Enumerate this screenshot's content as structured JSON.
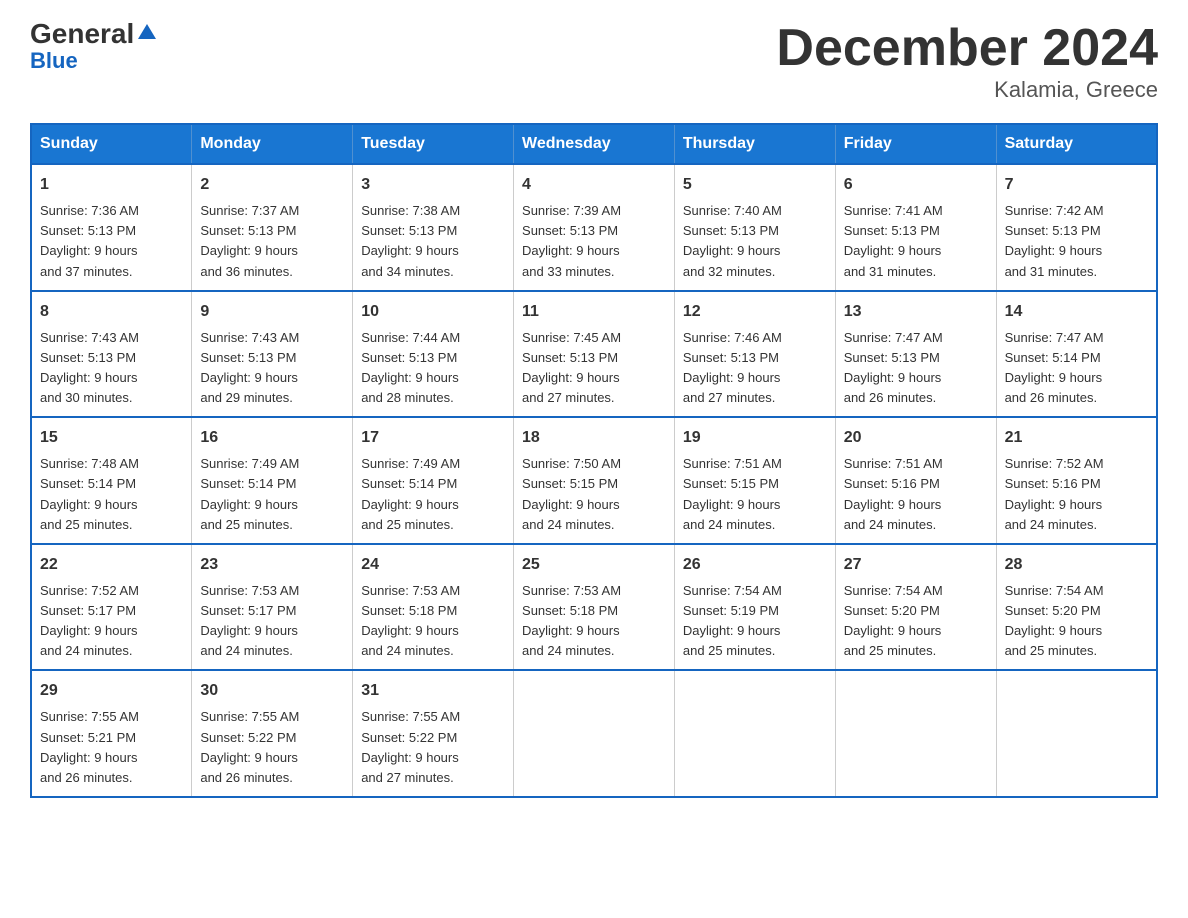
{
  "logo": {
    "name_general": "General",
    "name_blue": "Blue"
  },
  "title": "December 2024",
  "subtitle": "Kalamia, Greece",
  "days_header": [
    "Sunday",
    "Monday",
    "Tuesday",
    "Wednesday",
    "Thursday",
    "Friday",
    "Saturday"
  ],
  "weeks": [
    [
      {
        "day": "1",
        "sunrise": "7:36 AM",
        "sunset": "5:13 PM",
        "daylight": "9 hours and 37 minutes."
      },
      {
        "day": "2",
        "sunrise": "7:37 AM",
        "sunset": "5:13 PM",
        "daylight": "9 hours and 36 minutes."
      },
      {
        "day": "3",
        "sunrise": "7:38 AM",
        "sunset": "5:13 PM",
        "daylight": "9 hours and 34 minutes."
      },
      {
        "day": "4",
        "sunrise": "7:39 AM",
        "sunset": "5:13 PM",
        "daylight": "9 hours and 33 minutes."
      },
      {
        "day": "5",
        "sunrise": "7:40 AM",
        "sunset": "5:13 PM",
        "daylight": "9 hours and 32 minutes."
      },
      {
        "day": "6",
        "sunrise": "7:41 AM",
        "sunset": "5:13 PM",
        "daylight": "9 hours and 31 minutes."
      },
      {
        "day": "7",
        "sunrise": "7:42 AM",
        "sunset": "5:13 PM",
        "daylight": "9 hours and 31 minutes."
      }
    ],
    [
      {
        "day": "8",
        "sunrise": "7:43 AM",
        "sunset": "5:13 PM",
        "daylight": "9 hours and 30 minutes."
      },
      {
        "day": "9",
        "sunrise": "7:43 AM",
        "sunset": "5:13 PM",
        "daylight": "9 hours and 29 minutes."
      },
      {
        "day": "10",
        "sunrise": "7:44 AM",
        "sunset": "5:13 PM",
        "daylight": "9 hours and 28 minutes."
      },
      {
        "day": "11",
        "sunrise": "7:45 AM",
        "sunset": "5:13 PM",
        "daylight": "9 hours and 27 minutes."
      },
      {
        "day": "12",
        "sunrise": "7:46 AM",
        "sunset": "5:13 PM",
        "daylight": "9 hours and 27 minutes."
      },
      {
        "day": "13",
        "sunrise": "7:47 AM",
        "sunset": "5:13 PM",
        "daylight": "9 hours and 26 minutes."
      },
      {
        "day": "14",
        "sunrise": "7:47 AM",
        "sunset": "5:14 PM",
        "daylight": "9 hours and 26 minutes."
      }
    ],
    [
      {
        "day": "15",
        "sunrise": "7:48 AM",
        "sunset": "5:14 PM",
        "daylight": "9 hours and 25 minutes."
      },
      {
        "day": "16",
        "sunrise": "7:49 AM",
        "sunset": "5:14 PM",
        "daylight": "9 hours and 25 minutes."
      },
      {
        "day": "17",
        "sunrise": "7:49 AM",
        "sunset": "5:14 PM",
        "daylight": "9 hours and 25 minutes."
      },
      {
        "day": "18",
        "sunrise": "7:50 AM",
        "sunset": "5:15 PM",
        "daylight": "9 hours and 24 minutes."
      },
      {
        "day": "19",
        "sunrise": "7:51 AM",
        "sunset": "5:15 PM",
        "daylight": "9 hours and 24 minutes."
      },
      {
        "day": "20",
        "sunrise": "7:51 AM",
        "sunset": "5:16 PM",
        "daylight": "9 hours and 24 minutes."
      },
      {
        "day": "21",
        "sunrise": "7:52 AM",
        "sunset": "5:16 PM",
        "daylight": "9 hours and 24 minutes."
      }
    ],
    [
      {
        "day": "22",
        "sunrise": "7:52 AM",
        "sunset": "5:17 PM",
        "daylight": "9 hours and 24 minutes."
      },
      {
        "day": "23",
        "sunrise": "7:53 AM",
        "sunset": "5:17 PM",
        "daylight": "9 hours and 24 minutes."
      },
      {
        "day": "24",
        "sunrise": "7:53 AM",
        "sunset": "5:18 PM",
        "daylight": "9 hours and 24 minutes."
      },
      {
        "day": "25",
        "sunrise": "7:53 AM",
        "sunset": "5:18 PM",
        "daylight": "9 hours and 24 minutes."
      },
      {
        "day": "26",
        "sunrise": "7:54 AM",
        "sunset": "5:19 PM",
        "daylight": "9 hours and 25 minutes."
      },
      {
        "day": "27",
        "sunrise": "7:54 AM",
        "sunset": "5:20 PM",
        "daylight": "9 hours and 25 minutes."
      },
      {
        "day": "28",
        "sunrise": "7:54 AM",
        "sunset": "5:20 PM",
        "daylight": "9 hours and 25 minutes."
      }
    ],
    [
      {
        "day": "29",
        "sunrise": "7:55 AM",
        "sunset": "5:21 PM",
        "daylight": "9 hours and 26 minutes."
      },
      {
        "day": "30",
        "sunrise": "7:55 AM",
        "sunset": "5:22 PM",
        "daylight": "9 hours and 26 minutes."
      },
      {
        "day": "31",
        "sunrise": "7:55 AM",
        "sunset": "5:22 PM",
        "daylight": "9 hours and 27 minutes."
      },
      null,
      null,
      null,
      null
    ]
  ]
}
